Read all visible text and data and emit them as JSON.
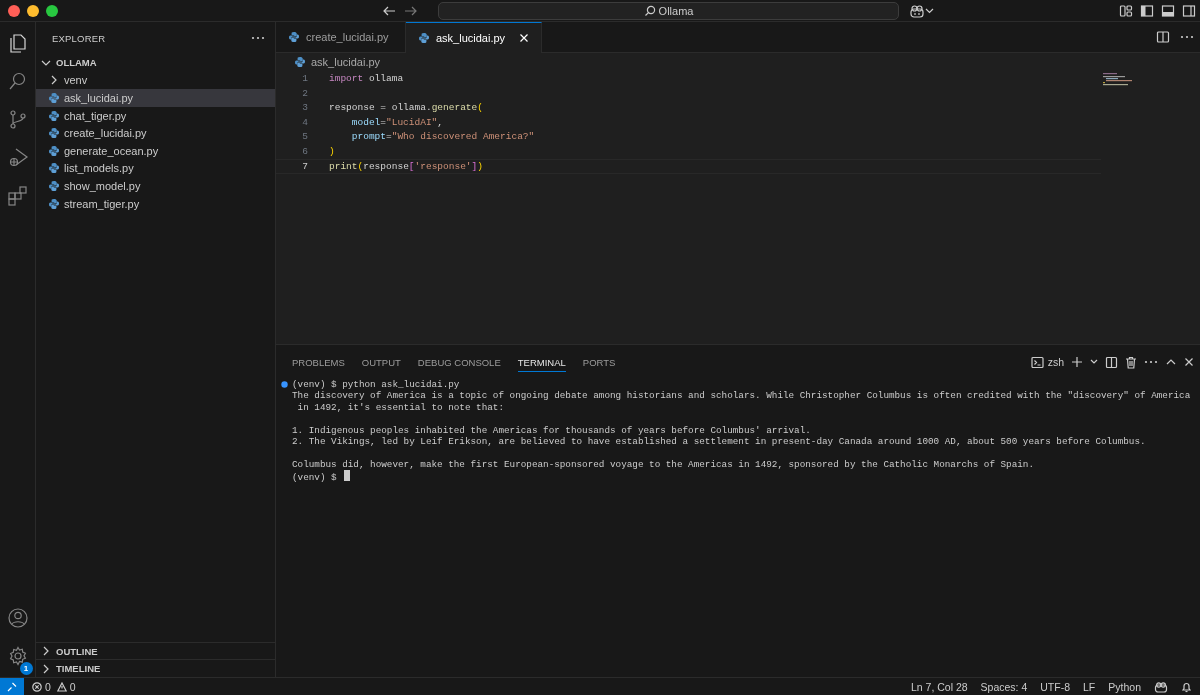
{
  "window": {
    "title": "Ollama"
  },
  "activity_bar": {
    "items": [
      {
        "kind": "explorer",
        "selected": true
      },
      {
        "kind": "search",
        "selected": false
      },
      {
        "kind": "source-control",
        "selected": false
      },
      {
        "kind": "run",
        "selected": false
      },
      {
        "kind": "extensions",
        "selected": false
      }
    ],
    "manage_badge": "1"
  },
  "sidebar": {
    "title": "EXPLORER",
    "folder": {
      "label": "OLLAMA",
      "expanded": true,
      "children": [
        {
          "label": "venv",
          "kind": "folder",
          "selected": false,
          "expanded": false
        },
        {
          "label": "ask_lucidai.py",
          "kind": "file",
          "selected": true
        },
        {
          "label": "chat_tiger.py",
          "kind": "file",
          "selected": false
        },
        {
          "label": "create_lucidai.py",
          "kind": "file",
          "selected": false
        },
        {
          "label": "generate_ocean.py",
          "kind": "file",
          "selected": false
        },
        {
          "label": "list_models.py",
          "kind": "file",
          "selected": false
        },
        {
          "label": "show_model.py",
          "kind": "file",
          "selected": false
        },
        {
          "label": "stream_tiger.py",
          "kind": "file",
          "selected": false
        }
      ]
    },
    "sections": [
      {
        "label": "OUTLINE",
        "expanded": false
      },
      {
        "label": "TIMELINE",
        "expanded": false
      }
    ]
  },
  "tabs": [
    {
      "label": "create_lucidai.py",
      "selected": false
    },
    {
      "label": "ask_lucidai.py",
      "selected": true
    }
  ],
  "breadcrumb": "ask_lucidai.py",
  "code": {
    "lines": [
      {
        "number": "1",
        "current": false,
        "indented": false,
        "tokens": [
          {
            "kind": "keyword",
            "text": "import"
          },
          {
            "kind": "plain",
            "text": " ollama"
          }
        ]
      },
      {
        "number": "2",
        "current": false,
        "indented": false
      },
      {
        "number": "3",
        "current": false,
        "indented": false,
        "tokens": [
          {
            "kind": "plain",
            "text": "response = ollama."
          },
          {
            "kind": "function",
            "text": "generate"
          },
          {
            "kind": "bracket",
            "text": "("
          }
        ]
      },
      {
        "number": "4",
        "current": false,
        "indented": true,
        "tokens": [
          {
            "kind": "param",
            "text": "model"
          },
          {
            "kind": "plain",
            "text": "="
          },
          {
            "kind": "string",
            "text": "\"LucidAI\""
          },
          {
            "kind": "plain",
            "text": ","
          }
        ]
      },
      {
        "number": "5",
        "current": false,
        "indented": true,
        "tokens": [
          {
            "kind": "param",
            "text": "prompt"
          },
          {
            "kind": "plain",
            "text": "="
          },
          {
            "kind": "string",
            "text": "\"Who discovered America?\""
          }
        ]
      },
      {
        "number": "6",
        "current": false,
        "indented": false,
        "tokens": [
          {
            "kind": "bracket",
            "text": ")"
          }
        ]
      },
      {
        "number": "7",
        "current": true,
        "indented": false,
        "tokens": [
          {
            "kind": "function",
            "text": "print"
          },
          {
            "kind": "bracket",
            "text": "("
          },
          {
            "kind": "plain",
            "text": "response"
          },
          {
            "kind": "bracket2",
            "text": "["
          },
          {
            "kind": "string",
            "text": "'response'"
          },
          {
            "kind": "bracket2",
            "text": "]"
          },
          {
            "kind": "bracket",
            "text": ")"
          }
        ]
      }
    ]
  },
  "panel": {
    "tabs": [
      {
        "label": "PROBLEMS",
        "selected": false
      },
      {
        "label": "OUTPUT",
        "selected": false
      },
      {
        "label": "DEBUG CONSOLE",
        "selected": false
      },
      {
        "label": "TERMINAL",
        "selected": true
      },
      {
        "label": "PORTS",
        "selected": false
      }
    ],
    "shell": "zsh",
    "terminal_lines": [
      {
        "kind": "command",
        "text": "(venv) $ python ask_lucidai.py"
      },
      {
        "kind": "output",
        "text": "The discovery of America is a topic of ongoing debate among historians and scholars. While Christopher Columbus is often credited with the \"discovery\" of America"
      },
      {
        "kind": "output",
        "text": " in 1492, it's essential to note that:"
      },
      {
        "kind": "blank"
      },
      {
        "kind": "output",
        "text": "1. Indigenous peoples inhabited the Americas for thousands of years before Columbus' arrival."
      },
      {
        "kind": "output",
        "text": "2. The Vikings, led by Leif Erikson, are believed to have established a settlement in present-day Canada around 1000 AD, about 500 years before Columbus."
      },
      {
        "kind": "blank"
      },
      {
        "kind": "output",
        "text": "Columbus did, however, make the first European-sponsored voyage to the Americas in 1492, sponsored by the Catholic Monarchs of Spain."
      },
      {
        "kind": "prompt",
        "text": "(venv) $"
      }
    ]
  },
  "status_bar": {
    "errors": "0",
    "warnings": "0",
    "items": [
      "Ln 7, Col 28",
      "Spaces: 4",
      "UTF-8",
      "LF",
      "Python"
    ]
  }
}
